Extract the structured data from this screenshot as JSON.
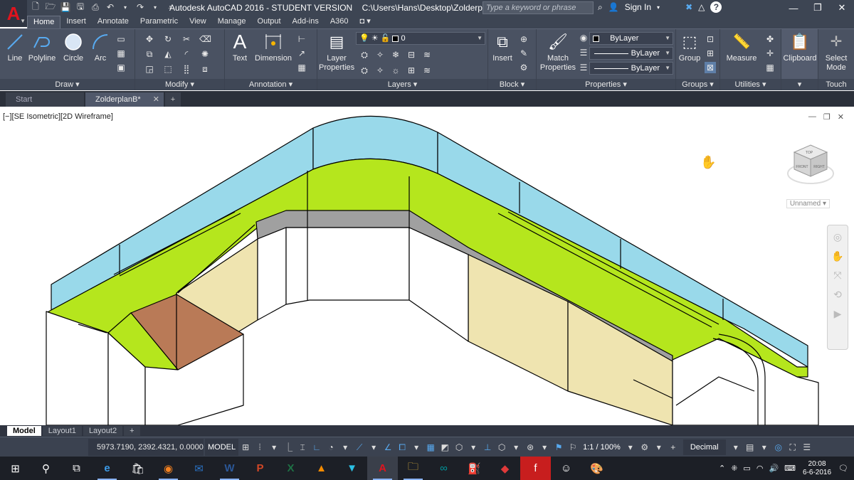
{
  "app": {
    "logo_letter": "A",
    "title": "Autodesk AutoCAD 2016 - STUDENT VERSION",
    "file_path": "C:\\Users\\Hans\\Desktop\\ZolderplanB.dwg",
    "search_placeholder": "Type a keyword or phrase",
    "sign_in": "Sign In"
  },
  "ribbon_tabs": [
    "Home",
    "Insert",
    "Annotate",
    "Parametric",
    "View",
    "Manage",
    "Output",
    "Add-ins",
    "A360"
  ],
  "active_ribbon_tab": "Home",
  "panels": {
    "draw": {
      "title": "Draw",
      "buttons": [
        "Line",
        "Polyline",
        "Circle",
        "Arc"
      ]
    },
    "modify": {
      "title": "Modify"
    },
    "annotation": {
      "title": "Annotation",
      "buttons": [
        "Text",
        "Dimension"
      ]
    },
    "layers": {
      "title": "Layers",
      "button_line1": "Layer",
      "button_line2": "Properties",
      "current_layer": "0"
    },
    "block": {
      "title": "Block",
      "button": "Insert"
    },
    "properties": {
      "title": "Properties",
      "button_line1": "Match",
      "button_line2": "Properties",
      "color": "ByLayer",
      "linetype": "ByLayer",
      "lineweight": "ByLayer"
    },
    "groups": {
      "title": "Groups",
      "button": "Group"
    },
    "utilities": {
      "title": "Utilities",
      "button": "Measure"
    },
    "clipboard": {
      "button": "Clipboard"
    },
    "touch": {
      "title": "Touch",
      "button_line1": "Select",
      "button_line2": "Mode"
    }
  },
  "doc_tabs": [
    "Start",
    "ZolderplanB*"
  ],
  "active_doc_tab": "ZolderplanB*",
  "viewport": {
    "label": "[−][SE Isometric][2D Wireframe]",
    "ucs_name": "Unnamed",
    "viewcube_top": "TOP",
    "viewcube_front": "FRONT",
    "viewcube_right": "RIGHT"
  },
  "layout_tabs": [
    "Model",
    "Layout1",
    "Layout2"
  ],
  "active_layout_tab": "Model",
  "status": {
    "coordinates": "5973.7190, 2392.4321, 0.0000",
    "model": "MODEL",
    "annotation_scale": "1:1 / 100%",
    "units": "Decimal"
  },
  "taskbar": {
    "time": "20:08",
    "date": "6-6-2016"
  },
  "colors": {
    "green_surface": "#b5e61d",
    "blue_wall": "#99d9ea",
    "tan_wall": "#efe4b0",
    "brown_top": "#b97a57",
    "gray_strip": "#a0a0a0",
    "autocad_red": "#e0141e"
  }
}
